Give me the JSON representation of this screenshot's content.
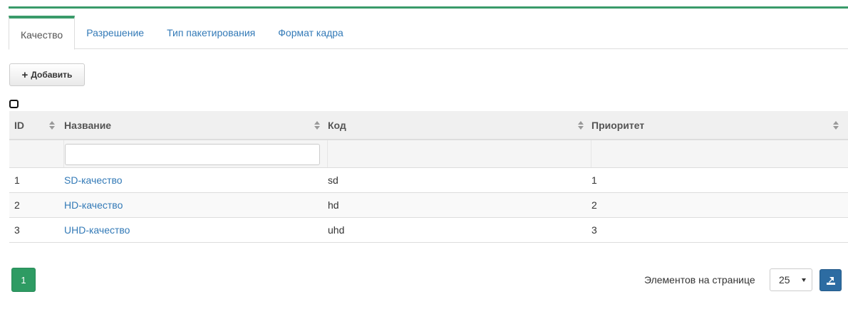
{
  "tabs": [
    {
      "label": "Качество",
      "active": true
    },
    {
      "label": "Разрешение",
      "active": false
    },
    {
      "label": "Тип пакетирования",
      "active": false
    },
    {
      "label": "Формат кадра",
      "active": false
    }
  ],
  "toolbar": {
    "add_label": "Добавить",
    "add_icon": "plus-icon"
  },
  "table": {
    "columns": [
      "ID",
      "Название",
      "Код",
      "Приоритет"
    ],
    "filter_name_value": "",
    "rows": [
      {
        "id": "1",
        "name": "SD-качество",
        "code": "sd",
        "priority": "1"
      },
      {
        "id": "2",
        "name": "HD-качество",
        "code": "hd",
        "priority": "2"
      },
      {
        "id": "3",
        "name": "UHD-качество",
        "code": "uhd",
        "priority": "3"
      }
    ]
  },
  "pagination": {
    "current_page": "1",
    "per_page_label": "Элементов на странице",
    "per_page_value": "25",
    "export_icon": "export-icon"
  },
  "colors": {
    "accent_green": "#3a9b6a",
    "link_blue": "#337ab7",
    "export_blue": "#2d6ca2"
  }
}
